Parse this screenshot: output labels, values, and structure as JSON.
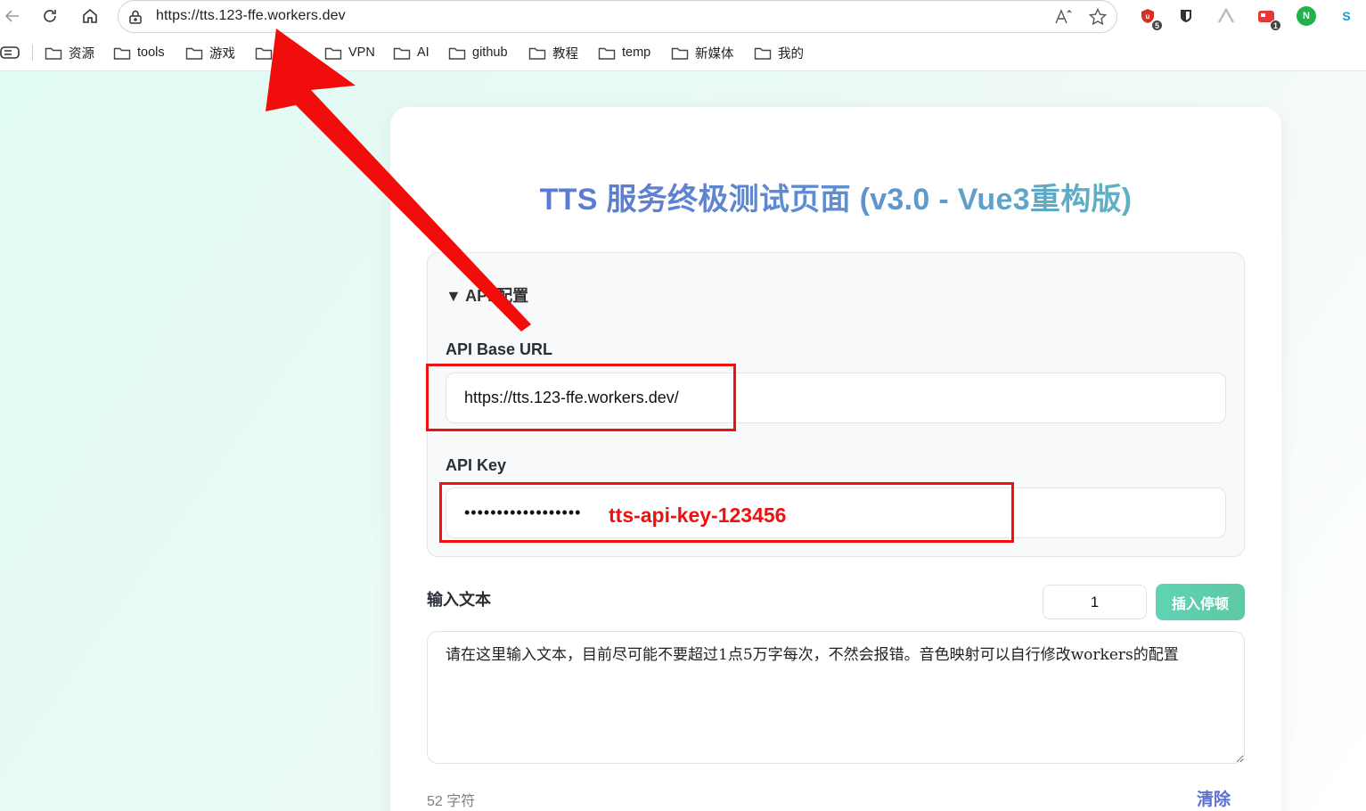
{
  "browser": {
    "address_url": "https://tts.123-ffe.workers.dev",
    "extensions": [
      {
        "name": "ublock-icon",
        "badge": "5",
        "color": "#d93025"
      },
      {
        "name": "bitwarden-icon",
        "badge": "",
        "color": "#333333"
      },
      {
        "name": "extension-a-icon",
        "badge": "",
        "color": "#bbbbbb"
      },
      {
        "name": "extension-red-icon",
        "badge": "1",
        "color": "#e53935"
      },
      {
        "name": "extension-n-icon",
        "badge": "",
        "color": "#21b24b"
      },
      {
        "name": "extension-s-icon",
        "badge": "",
        "color": "#1a9bd7"
      }
    ]
  },
  "bookmarks": [
    {
      "label": "资源"
    },
    {
      "label": "tools"
    },
    {
      "label": "游戏"
    },
    {
      "label": "网"
    },
    {
      "label": "VPN"
    },
    {
      "label": "AI"
    },
    {
      "label": "github"
    },
    {
      "label": "教程"
    },
    {
      "label": "temp"
    },
    {
      "label": "新媒体"
    },
    {
      "label": "我的"
    }
  ],
  "page": {
    "title": "TTS 服务终极测试页面 (v3.0 - Vue3重构版)",
    "api_section": {
      "summary": "▼ API 配置",
      "base_url_label": "API Base URL",
      "base_url_value": "https://tts.123-ffe.workers.dev/",
      "api_key_label": "API Key",
      "api_key_masked": "••••••••••••••••••"
    },
    "text_section": {
      "label": "输入文本",
      "pause_value": "1",
      "insert_pause_button": "插入停顿",
      "text_value": "请在这里输入文本，目前尽可能不要超过1点5万字每次，不然会报错。音色映射可以自行修改workers的配置",
      "char_count": "52 字符",
      "clear_button": "清除"
    }
  },
  "annotations": {
    "api_key_note": "tts-api-key-123456",
    "color": "#ee1111"
  }
}
